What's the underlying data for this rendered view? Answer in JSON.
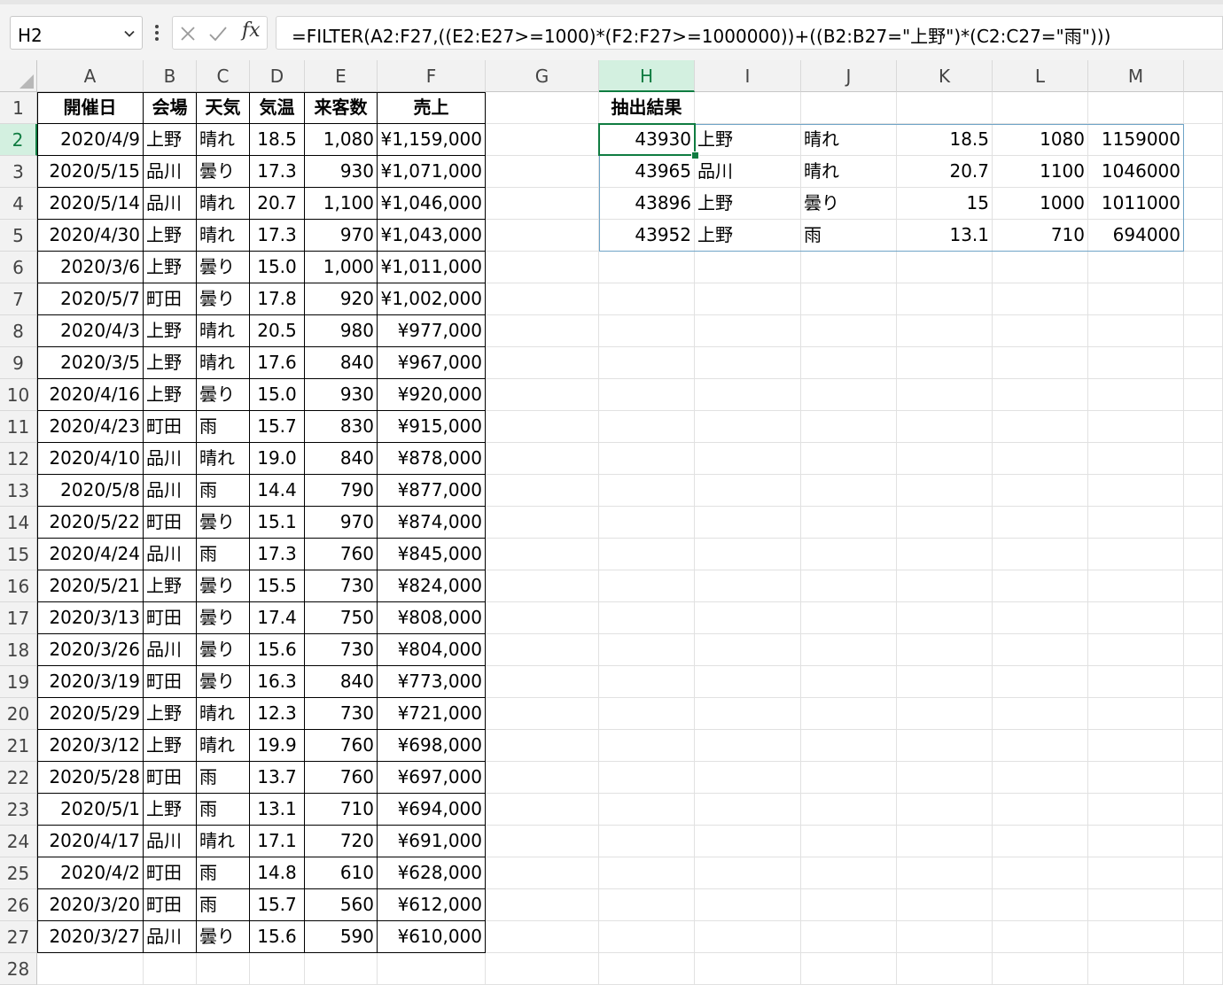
{
  "name_box": {
    "value": "H2"
  },
  "formula_bar": {
    "fx_label": "fx",
    "formula": "=FILTER(A2:F27,((E2:E27>=1000)*(F2:F27>=1000000))+((B2:B27=\"上野\")*(C2:C27=\"雨\")))"
  },
  "columns": [
    "A",
    "B",
    "C",
    "D",
    "E",
    "F",
    "G",
    "H",
    "I",
    "J",
    "K",
    "L",
    "M"
  ],
  "selected": {
    "cell": "H2",
    "column": "H",
    "row": 2
  },
  "rows_visible": 28,
  "source_table": {
    "headers": [
      "開催日",
      "会場",
      "天気",
      "気温",
      "来客数",
      "売上"
    ],
    "rows": [
      [
        "2020/4/9",
        "上野",
        "晴れ",
        "18.5",
        "1,080",
        "¥1,159,000"
      ],
      [
        "2020/5/15",
        "品川",
        "曇り",
        "17.3",
        "930",
        "¥1,071,000"
      ],
      [
        "2020/5/14",
        "品川",
        "晴れ",
        "20.7",
        "1,100",
        "¥1,046,000"
      ],
      [
        "2020/4/30",
        "上野",
        "晴れ",
        "17.3",
        "970",
        "¥1,043,000"
      ],
      [
        "2020/3/6",
        "上野",
        "曇り",
        "15.0",
        "1,000",
        "¥1,011,000"
      ],
      [
        "2020/5/7",
        "町田",
        "曇り",
        "17.8",
        "920",
        "¥1,002,000"
      ],
      [
        "2020/4/3",
        "上野",
        "晴れ",
        "20.5",
        "980",
        "¥977,000"
      ],
      [
        "2020/3/5",
        "上野",
        "晴れ",
        "17.6",
        "840",
        "¥967,000"
      ],
      [
        "2020/4/16",
        "上野",
        "曇り",
        "15.0",
        "930",
        "¥920,000"
      ],
      [
        "2020/4/23",
        "町田",
        "雨",
        "15.7",
        "830",
        "¥915,000"
      ],
      [
        "2020/4/10",
        "品川",
        "晴れ",
        "19.0",
        "840",
        "¥878,000"
      ],
      [
        "2020/5/8",
        "品川",
        "雨",
        "14.4",
        "790",
        "¥877,000"
      ],
      [
        "2020/5/22",
        "町田",
        "曇り",
        "15.1",
        "970",
        "¥874,000"
      ],
      [
        "2020/4/24",
        "品川",
        "雨",
        "17.3",
        "760",
        "¥845,000"
      ],
      [
        "2020/5/21",
        "上野",
        "曇り",
        "15.5",
        "730",
        "¥824,000"
      ],
      [
        "2020/3/13",
        "町田",
        "曇り",
        "17.4",
        "750",
        "¥808,000"
      ],
      [
        "2020/3/26",
        "品川",
        "曇り",
        "15.6",
        "730",
        "¥804,000"
      ],
      [
        "2020/3/19",
        "町田",
        "曇り",
        "16.3",
        "840",
        "¥773,000"
      ],
      [
        "2020/5/29",
        "上野",
        "晴れ",
        "12.3",
        "730",
        "¥721,000"
      ],
      [
        "2020/3/12",
        "上野",
        "晴れ",
        "19.9",
        "760",
        "¥698,000"
      ],
      [
        "2020/5/28",
        "町田",
        "雨",
        "13.7",
        "760",
        "¥697,000"
      ],
      [
        "2020/5/1",
        "上野",
        "雨",
        "13.1",
        "710",
        "¥694,000"
      ],
      [
        "2020/4/17",
        "品川",
        "晴れ",
        "17.1",
        "720",
        "¥691,000"
      ],
      [
        "2020/4/2",
        "町田",
        "雨",
        "14.8",
        "610",
        "¥628,000"
      ],
      [
        "2020/3/20",
        "町田",
        "雨",
        "15.7",
        "560",
        "¥612,000"
      ],
      [
        "2020/3/27",
        "品川",
        "曇り",
        "15.6",
        "590",
        "¥610,000"
      ]
    ]
  },
  "result_table": {
    "title": "抽出結果",
    "rows": [
      [
        "43930",
        "上野",
        "晴れ",
        "18.5",
        "1080",
        "1159000"
      ],
      [
        "43965",
        "品川",
        "晴れ",
        "20.7",
        "1100",
        "1046000"
      ],
      [
        "43896",
        "上野",
        "曇り",
        "15",
        "1000",
        "1011000"
      ],
      [
        "43952",
        "上野",
        "雨",
        "13.1",
        "710",
        "694000"
      ]
    ]
  }
}
